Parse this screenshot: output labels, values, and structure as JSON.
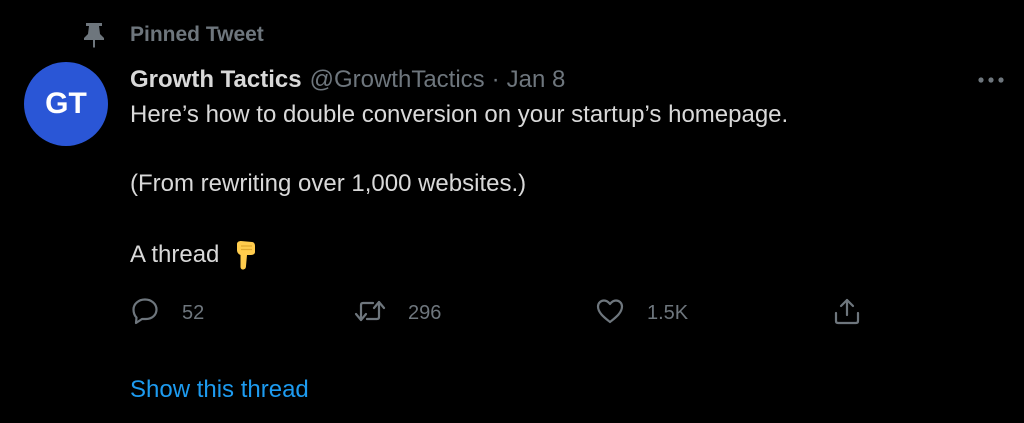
{
  "pinned": {
    "label": "Pinned Tweet",
    "icon": "pin-icon"
  },
  "author": {
    "avatar_initials": "GT",
    "avatar_color": "#2a56d6",
    "name": "Growth Tactics",
    "handle": "@GrowthTactics",
    "separator": "·",
    "date": "Jan 8"
  },
  "tweet": {
    "lines": [
      "Here’s how to double conversion on your startup’s homepage.",
      "(From rewriting over 1,000 websites.)",
      "A thread"
    ],
    "emoji": "backhand-index-pointing-down"
  },
  "actions": {
    "reply_count": "52",
    "retweet_count": "296",
    "like_count": "1.5K"
  },
  "show_thread_label": "Show this thread",
  "colors": {
    "background": "#000000",
    "text": "#d9d9d9",
    "secondary": "#6e767d",
    "link": "#1d9bf0"
  }
}
